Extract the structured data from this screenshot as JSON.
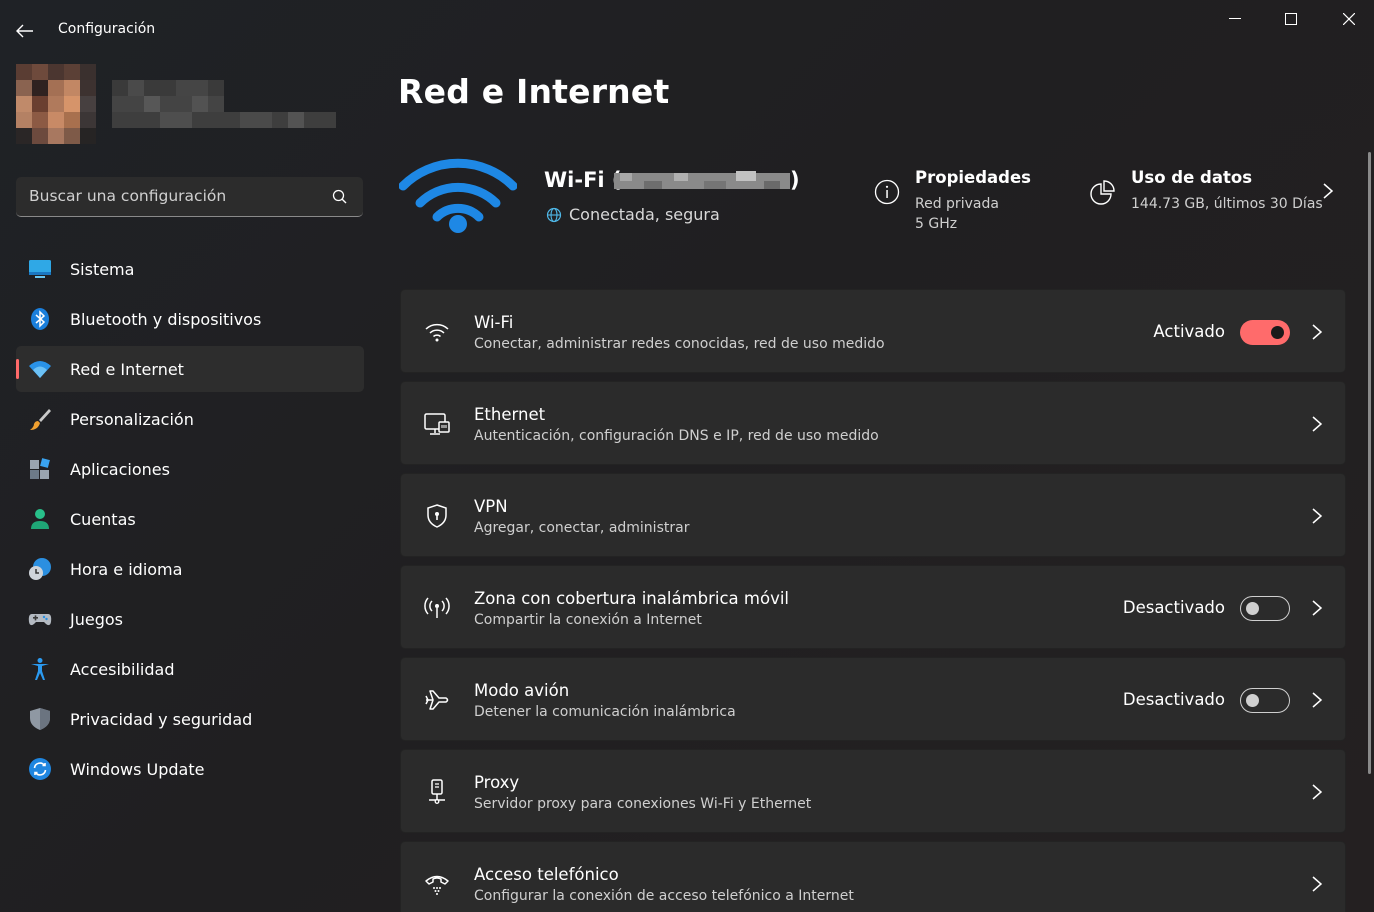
{
  "window": {
    "app_title": "Configuración"
  },
  "search": {
    "placeholder": "Buscar una configuración"
  },
  "sidebar": {
    "items": [
      {
        "label": "Sistema",
        "icon": "system-icon"
      },
      {
        "label": "Bluetooth y dispositivos",
        "icon": "bluetooth-icon"
      },
      {
        "label": "Red e Internet",
        "icon": "network-icon",
        "active": true
      },
      {
        "label": "Personalización",
        "icon": "brush-icon"
      },
      {
        "label": "Aplicaciones",
        "icon": "apps-icon"
      },
      {
        "label": "Cuentas",
        "icon": "account-icon"
      },
      {
        "label": "Hora e idioma",
        "icon": "clock-globe-icon"
      },
      {
        "label": "Juegos",
        "icon": "gamepad-icon"
      },
      {
        "label": "Accesibilidad",
        "icon": "accessibility-icon"
      },
      {
        "label": "Privacidad y seguridad",
        "icon": "shield-icon"
      },
      {
        "label": "Windows Update",
        "icon": "update-icon"
      }
    ]
  },
  "main": {
    "title": "Red e Internet",
    "hero": {
      "ssid_prefix": "Wi-Fi (",
      "ssid_suffix": ")",
      "status": "Conectada, segura",
      "properties": {
        "title": "Propiedades",
        "line1": "Red privada",
        "line2": "5 GHz"
      },
      "data_usage": {
        "title": "Uso de datos",
        "line1": "144.73 GB, últimos 30 Días"
      }
    },
    "cards": [
      {
        "title": "Wi-Fi",
        "subtitle": "Conectar, administrar redes conocidas, red de uso medido",
        "state": "Activado",
        "toggle": "on",
        "icon": "wifi-icon"
      },
      {
        "title": "Ethernet",
        "subtitle": "Autenticación, configuración DNS e IP, red de uso medido",
        "state": "",
        "toggle": "none",
        "icon": "ethernet-icon"
      },
      {
        "title": "VPN",
        "subtitle": "Agregar, conectar, administrar",
        "state": "",
        "toggle": "none",
        "icon": "vpn-shield-icon"
      },
      {
        "title": "Zona con cobertura inalámbrica móvil",
        "subtitle": "Compartir la conexión a Internet",
        "state": "Desactivado",
        "toggle": "off",
        "icon": "hotspot-icon"
      },
      {
        "title": "Modo avión",
        "subtitle": "Detener la comunicación inalámbrica",
        "state": "Desactivado",
        "toggle": "off",
        "icon": "airplane-icon"
      },
      {
        "title": "Proxy",
        "subtitle": "Servidor proxy para conexiones Wi-Fi y Ethernet",
        "state": "",
        "toggle": "none",
        "icon": "proxy-icon"
      },
      {
        "title": "Acceso telefónico",
        "subtitle": "Configurar la conexión de acceso telefónico a Internet",
        "state": "",
        "toggle": "none",
        "icon": "dialup-icon"
      }
    ]
  },
  "colors": {
    "accent": "#ff6b6b",
    "wifi_blue": "#1e88e5"
  }
}
